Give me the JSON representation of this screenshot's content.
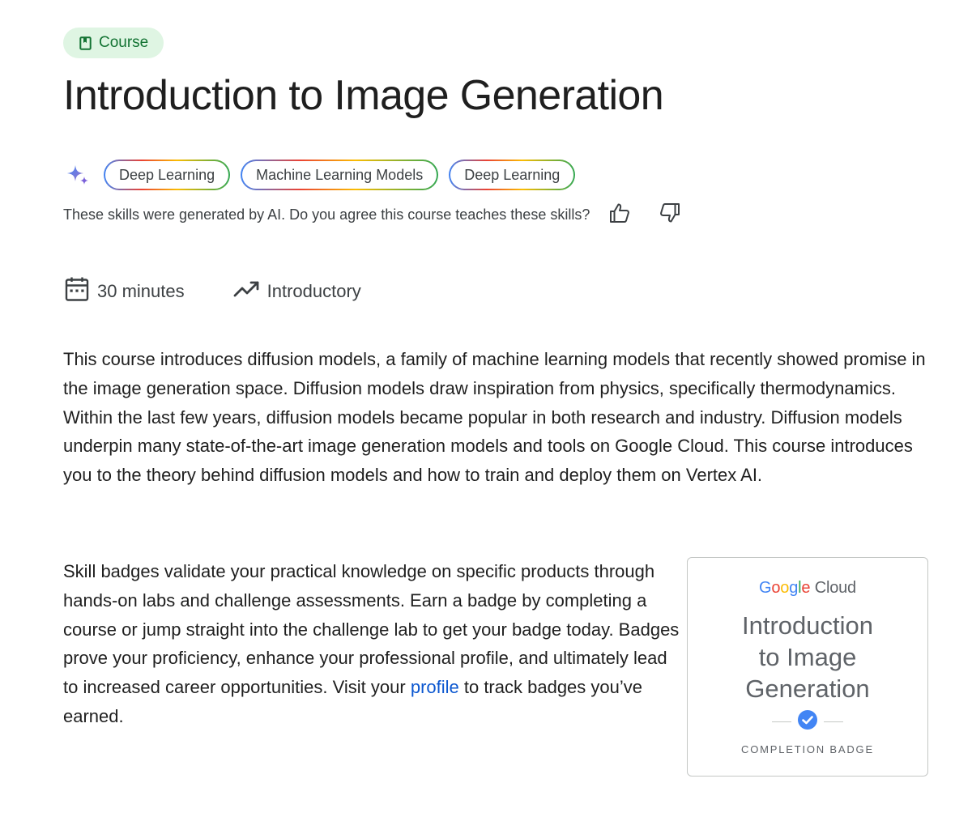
{
  "course_type": {
    "label": "Course",
    "icon": "book-icon",
    "color": "#137333",
    "bg": "#dff5e3"
  },
  "title": "Introduction to Image Generation",
  "skills": {
    "ai_icon": "sparkle-icon",
    "items": [
      {
        "label": "Deep Learning"
      },
      {
        "label": "Machine Learning Models"
      },
      {
        "label": "Deep Learning"
      }
    ],
    "ai_note": "These skills were generated by AI. Do you agree this course teaches these skills?",
    "feedback_icons": [
      "thumb-up-icon",
      "thumb-down-icon"
    ]
  },
  "meta": {
    "duration": {
      "icon": "calendar-icon",
      "label": "30 minutes"
    },
    "level": {
      "icon": "trending-up-icon",
      "label": "Introductory"
    }
  },
  "description": "This course introduces diffusion models, a family of machine learning models that recently showed promise in the image generation space. Diffusion models draw inspiration from physics, specifically thermodynamics. Within the last few years, diffusion models became popular in both research and industry. Diffusion models underpin many state-of-the-art image generation models and tools on Google Cloud. This course introduces you to the theory behind diffusion models and how to train and deploy them on Vertex AI.",
  "badge_info": {
    "text_before_link": "Skill badges validate your practical knowledge on specific products through hands-on labs and challenge assessments. Earn a badge by completing a course or jump straight into the challenge lab to get your badge today. Badges prove your proficiency, enhance your professional profile, and ultimately lead to increased career opportunities. Visit your ",
    "link_text": "profile",
    "text_after_link": " to track badges you’ve earned."
  },
  "badge_card": {
    "logo": {
      "G": "G",
      "o1": "o",
      "o2": "o",
      "g": "g",
      "l": "l",
      "e": "e",
      "cloud": "Cloud"
    },
    "title_lines": [
      "Introduction",
      "to Image",
      "Generation"
    ],
    "check_icon": "check-circle-icon",
    "label": "COMPLETION BADGE"
  },
  "colors": {
    "link": "#0b57d0",
    "check": "#4285f4"
  }
}
